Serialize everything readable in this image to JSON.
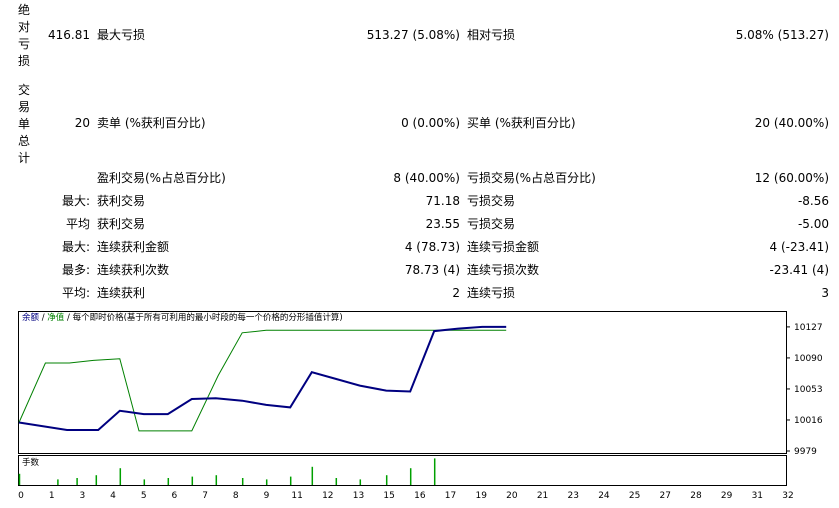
{
  "summary": {
    "side_label_1": "绝对亏损",
    "side_label_1_chars": [
      "绝",
      "对",
      "亏",
      "损"
    ],
    "side_label_2": "交易单总计",
    "side_label_2_chars": [
      "交",
      "易",
      "单",
      "总",
      "计"
    ],
    "abs_drawdown_value": "416.81",
    "max_drawdown_label": "最大亏损",
    "max_drawdown_value": "513.27 (5.08%)",
    "rel_drawdown_label": "相对亏损",
    "rel_drawdown_value": "5.08% (513.27)",
    "total_trades_value": "20",
    "short_label": "卖单 (%获利百分比)",
    "short_value": "0 (0.00%)",
    "long_label": "买单 (%获利百分比)",
    "long_value": "20 (40.00%)"
  },
  "stats_rows": [
    {
      "prefix": "",
      "l_label": "盈利交易(%占总百分比)",
      "l_value": "8 (40.00%)",
      "r_label": "亏损交易(%占总百分比)",
      "r_value": "12 (60.00%)"
    },
    {
      "prefix": "最大:",
      "l_label": "获利交易",
      "l_value": "71.18",
      "r_label": "亏损交易",
      "r_value": "-8.56"
    },
    {
      "prefix": "平均",
      "l_label": "获利交易",
      "l_value": "23.55",
      "r_label": "亏损交易",
      "r_value": "-5.00"
    },
    {
      "prefix": "最大:",
      "l_label": "连续获利金额",
      "l_value": "4 (78.73)",
      "r_label": "连续亏损金额",
      "r_value": "4 (-23.41)"
    },
    {
      "prefix": "最多:",
      "l_label": "连续获利次数",
      "l_value": "78.73 (4)",
      "r_label": "连续亏损次数",
      "r_value": "-23.41 (4)"
    },
    {
      "prefix": "平均:",
      "l_label": "连续获利",
      "l_value": "2",
      "r_label": "连续亏损",
      "r_value": "3"
    }
  ],
  "chart_data": {
    "type": "line",
    "legend": {
      "balance": "余额",
      "sep1": "/",
      "equity": "净值",
      "sep2": "/",
      "desc": "每个即时价格(基于所有可利用的最小时段的每一个价格的分形插值计算)"
    },
    "series": [
      {
        "name": "余额",
        "color": "#000080",
        "x": [
          0,
          2,
          3.3,
          4.2,
          5.2,
          6.2,
          7.2,
          8.2,
          9.3,
          10.3,
          11.3,
          12.2,
          13.2,
          14.2,
          15.3,
          16.3,
          17.3,
          18.3,
          19.3,
          20.3
        ],
        "values": [
          10013,
          10004,
          10004,
          10027,
          10023,
          10023,
          10041,
          10042,
          10039,
          10034,
          10031,
          10073,
          10065,
          10057,
          10051,
          10050,
          10122,
          10125,
          10127,
          10127
        ]
      },
      {
        "name": "净值",
        "color": "#008000",
        "x": [
          0,
          1.1,
          2.1,
          3.1,
          4.2,
          5.0,
          5.8,
          7.2,
          8.3,
          9.3,
          10.3,
          11.3,
          12.3,
          13.3,
          14.3,
          15.3,
          16.3,
          17.3,
          18.3,
          19.3,
          20.3
        ],
        "values": [
          10013,
          10084,
          10084,
          10087,
          10089,
          10003,
          10003,
          10003,
          10069,
          10120,
          10123,
          10123,
          10123,
          10123,
          10123,
          10123,
          10123,
          10123,
          10123,
          10123,
          10123
        ]
      }
    ],
    "y_ticks": [
      10127,
      10090,
      10053,
      10016,
      9979
    ],
    "ylim": [
      9979,
      10140
    ],
    "x_ticks": [
      0,
      1,
      3,
      4,
      5,
      6,
      7,
      8,
      9,
      11,
      12,
      13,
      15,
      16,
      17,
      19,
      20,
      21,
      23,
      24,
      25,
      27,
      28,
      29,
      31,
      32
    ],
    "volume": {
      "label": "手数",
      "bars": [
        {
          "x": 0.0,
          "h": 0.4
        },
        {
          "x": 1.6,
          "h": 0.2
        },
        {
          "x": 2.4,
          "h": 0.25
        },
        {
          "x": 3.2,
          "h": 0.35
        },
        {
          "x": 4.2,
          "h": 0.6
        },
        {
          "x": 5.2,
          "h": 0.2
        },
        {
          "x": 6.2,
          "h": 0.25
        },
        {
          "x": 7.2,
          "h": 0.3
        },
        {
          "x": 8.2,
          "h": 0.35
        },
        {
          "x": 9.3,
          "h": 0.25
        },
        {
          "x": 10.3,
          "h": 0.2
        },
        {
          "x": 11.3,
          "h": 0.3
        },
        {
          "x": 12.2,
          "h": 0.65
        },
        {
          "x": 13.2,
          "h": 0.25
        },
        {
          "x": 14.2,
          "h": 0.2
        },
        {
          "x": 15.3,
          "h": 0.35
        },
        {
          "x": 16.3,
          "h": 0.6
        },
        {
          "x": 17.3,
          "h": 0.95
        }
      ]
    }
  }
}
